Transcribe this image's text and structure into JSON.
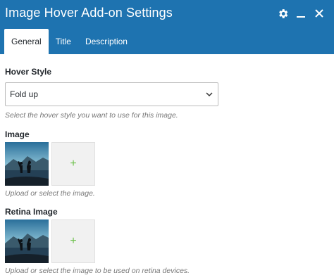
{
  "window": {
    "title": "Image Hover Add-on Settings"
  },
  "header_icons": [
    "gear-icon",
    "minimize-icon",
    "close-icon"
  ],
  "tabs": [
    {
      "label": "General",
      "active": true
    },
    {
      "label": "Title",
      "active": false
    },
    {
      "label": "Description",
      "active": false
    }
  ],
  "hover_style": {
    "label": "Hover Style",
    "value": "Fold up",
    "help": "Select the hover style you want to use for this image."
  },
  "image": {
    "label": "Image",
    "add_glyph": "+",
    "help": "Upload or select the image."
  },
  "retina_image": {
    "label": "Retina Image",
    "add_glyph": "+",
    "help": "Upload or select the image to be used on retina devices."
  },
  "colors": {
    "header_bg": "#1e73b0",
    "add_plus": "#6cc04a"
  }
}
